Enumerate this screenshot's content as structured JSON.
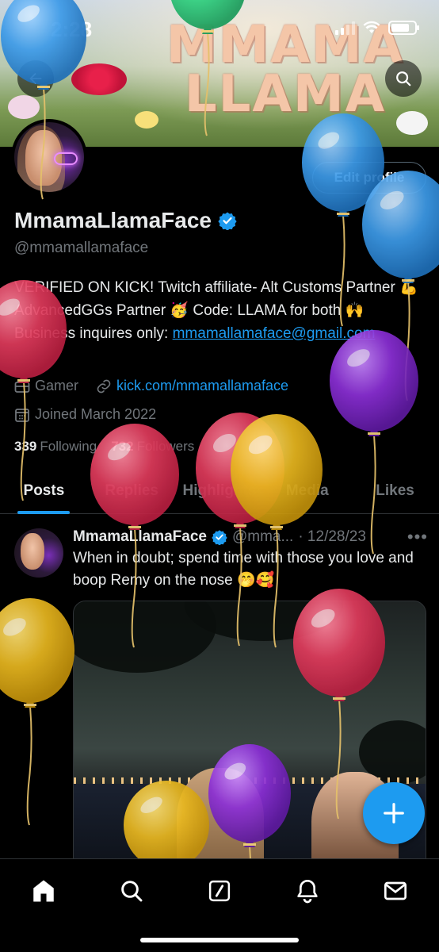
{
  "status_bar": {
    "time": "2:28"
  },
  "banner": {
    "title_line1": "MMAMA",
    "title_line2": "LLAMA"
  },
  "profile": {
    "edit_label": "Edit profile",
    "display_name": "MmamaLlamaFace",
    "handle": "@mmamallamaface",
    "bio_text": "VERIFIED ON KICK! Twitch affiliate- Alt Customs Partner 💪 AdvancedGGs Partner 🥳 Code: LLAMA for both 🙌 Business inquires only:",
    "bio_email": "mmamallamaface@gmail.com",
    "category": "Gamer",
    "website": "kick.com/mmamallamaface",
    "joined": "Joined March 2022",
    "following_count": "339",
    "following_label": "Following",
    "followers_count": "732",
    "followers_label": "Followers"
  },
  "tabs": [
    {
      "label": "Posts",
      "active": true
    },
    {
      "label": "Replies"
    },
    {
      "label": "Highlights"
    },
    {
      "label": "Media"
    },
    {
      "label": "Likes"
    }
  ],
  "post": {
    "name": "MmamaLlamaFace",
    "handle": "@mma...",
    "date": "· 12/28/23",
    "more": "•••",
    "text": "When in doubt; spend time with those you love and boop Remy on the nose 🤭🥰"
  },
  "icons": {
    "back": "back-arrow-icon",
    "search": "search-icon",
    "verified": "verified-badge-icon",
    "category": "briefcase-icon",
    "link": "link-icon",
    "calendar": "calendar-icon",
    "compose": "plus-icon",
    "nav": [
      "home-icon",
      "search-icon",
      "grok-icon",
      "notifications-icon",
      "messages-icon"
    ]
  },
  "colors": {
    "accent": "#1d9bf0",
    "background": "#000000",
    "text_primary": "#e7e9ea",
    "text_secondary": "#71767b",
    "balloon_red": "#e03b5c",
    "balloon_blue": "#3d9be9",
    "balloon_yellow": "#e9b820",
    "balloon_purple": "#8b2fd6",
    "balloon_green": "#2ecf7e"
  }
}
